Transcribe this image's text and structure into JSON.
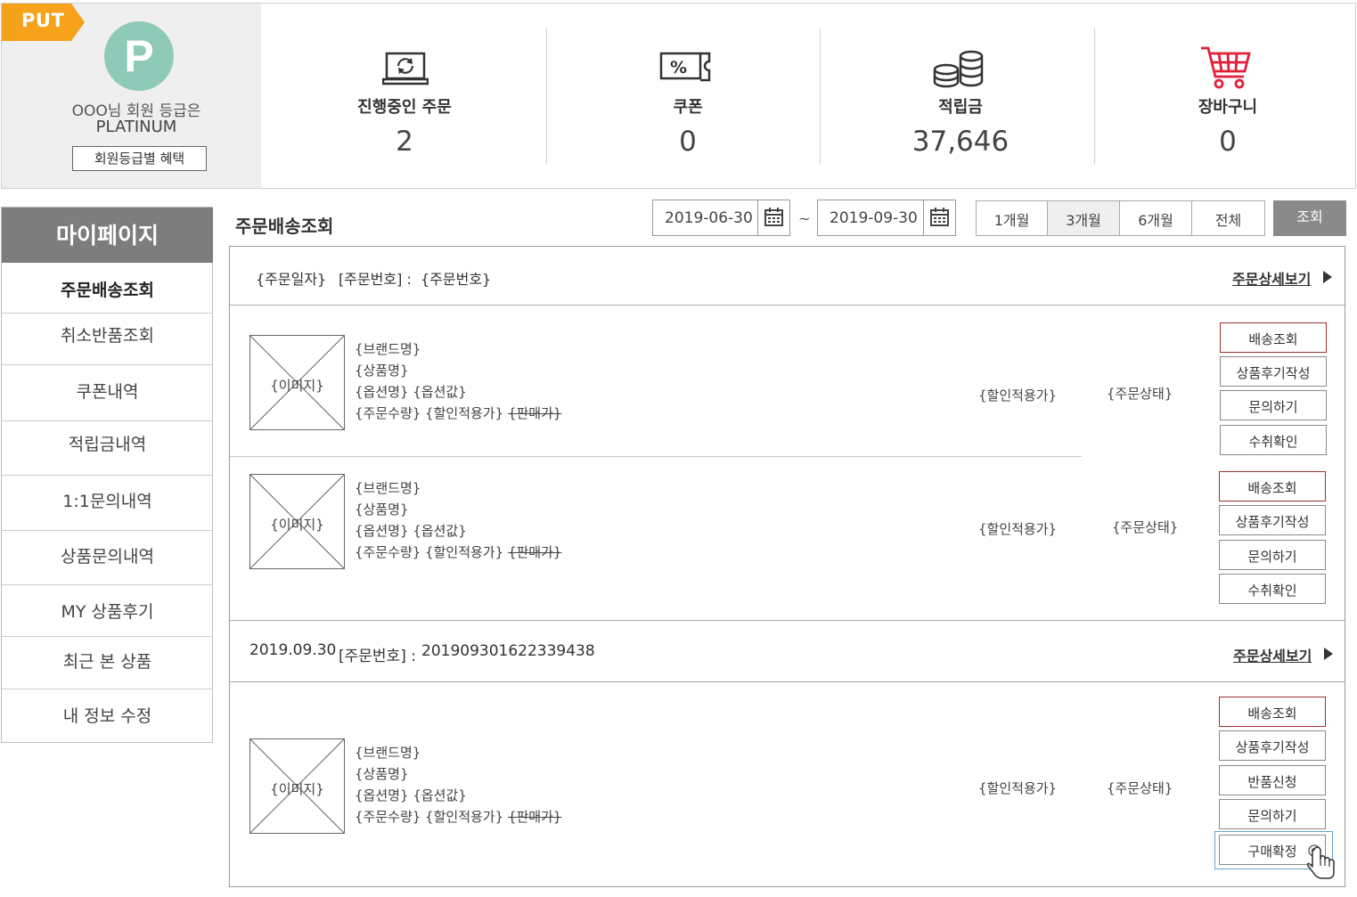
{
  "profile": {
    "badge": "PUT",
    "avatar_letter": "P",
    "grade_line": "OOO님 회원 등급은",
    "grade_name": "PLATINUM",
    "benefit_button": "회원등급별 혜택"
  },
  "stats": [
    {
      "icon": "laptop-refresh-icon",
      "title": "진행중인 주문",
      "value": "2"
    },
    {
      "icon": "coupon-icon",
      "title": "쿠폰",
      "value": "0"
    },
    {
      "icon": "coins-icon",
      "title": "적립금",
      "value": "37,646"
    },
    {
      "icon": "cart-icon",
      "title": "장바구니",
      "value": "0"
    }
  ],
  "sidebar": {
    "title": "마이페이지",
    "items": [
      {
        "label": "주문배송조회"
      },
      {
        "label": "취소반품조회"
      },
      {
        "label": "쿠폰내역"
      },
      {
        "label": "적립금내역"
      },
      {
        "label": "1:1문의내역"
      },
      {
        "label": "상품문의내역"
      },
      {
        "label": "MY 상품후기"
      },
      {
        "label": "최근 본 상품"
      },
      {
        "label": "내 정보 수정"
      }
    ]
  },
  "filter": {
    "page_title": "주문배송조회",
    "start_date": "2019-06-30",
    "end_date": "2019-09-30",
    "tilde": "~",
    "periods": [
      "1개월",
      "3개월",
      "6개월",
      "전체"
    ],
    "selected_period": "3개월",
    "search": "조회"
  },
  "orders": [
    {
      "date": "{주문일자}",
      "number_label": "[주문번호] :",
      "number": "{주문번호}",
      "detail": "주문상세보기",
      "items": [
        {
          "image": "{이미지}",
          "brand": "{브랜드명}",
          "product": "{상품명}",
          "option": "{옵션명} {옵션값}",
          "qty_price": "{주문수량} {할인적용가}",
          "original_price": "{판매가}",
          "price": "{할인적용가}",
          "status": "{주문상태}",
          "actions": [
            "배송조회",
            "상품후기작성",
            "문의하기",
            "수취확인"
          ]
        },
        {
          "image": "{이미지}",
          "brand": "{브랜드명}",
          "product": "{상품명}",
          "option": "{옵션명} {옵션값}",
          "qty_price": "{주문수량} {할인적용가}",
          "original_price": "{판매가}",
          "price": "{할인적용가}",
          "status": "{주문상태}",
          "actions": [
            "배송조회",
            "상품후기작성",
            "문의하기",
            "수취확인"
          ]
        }
      ]
    },
    {
      "date": "2019.09.30",
      "number_label": "[주문번호] :",
      "number": "201909301622339438",
      "detail": "주문상세보기",
      "items": [
        {
          "image": "{이미지}",
          "brand": "{브랜드명}",
          "product": "{상품명}",
          "option": "{옵션명} {옵션값}",
          "qty_price": "{주문수량} {할인적용가}",
          "original_price": "{판매가}",
          "price": "{할인적용가}",
          "status": "{주문상태}",
          "actions": [
            "배송조회",
            "상품후기작성",
            "반품신청",
            "문의하기",
            "구매확정"
          ]
        }
      ]
    }
  ],
  "colors": {
    "badge": "#f7a21b",
    "avatar": "#8ecab7",
    "sidebar_head": "#7d7d7d",
    "cart": "#e0203a",
    "accent_border": "#a03030"
  }
}
